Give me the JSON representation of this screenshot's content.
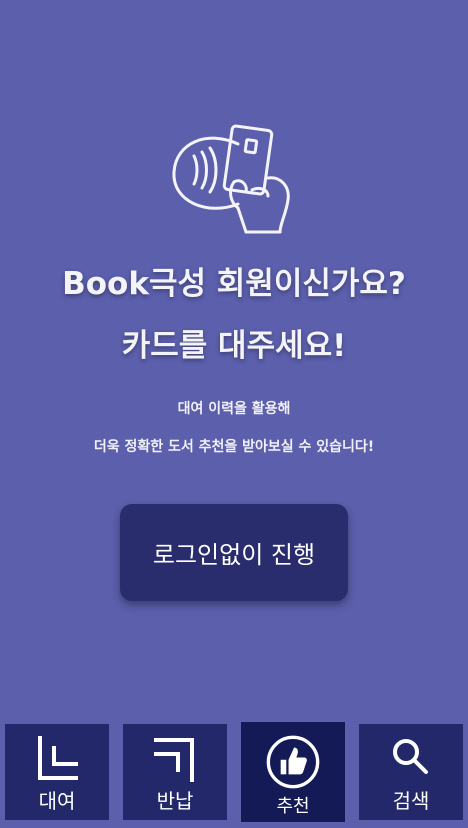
{
  "hero": {
    "icon": "nfc-card-tap-icon",
    "title_line1": "Book극성 회원이신가요?",
    "title_line2": "카드를 대주세요!",
    "desc_line1": "대여 이력을 활용해",
    "desc_line2": "더욱 정확한 도서 추천을 받아보실 수 있습니다!"
  },
  "proceed_button": {
    "label": "로그인없이 진행"
  },
  "tabs": [
    {
      "label": "대여",
      "icon": "rent-icon",
      "active": false
    },
    {
      "label": "반납",
      "icon": "return-icon",
      "active": false
    },
    {
      "label": "추천",
      "icon": "thumbs-up-icon",
      "active": true
    },
    {
      "label": "검색",
      "icon": "search-icon",
      "active": false
    }
  ],
  "colors": {
    "background": "#5b5fac",
    "button": "#2a2d6d",
    "tab": "#22286a",
    "tab_active": "#131a55",
    "text": "#ffffff"
  }
}
